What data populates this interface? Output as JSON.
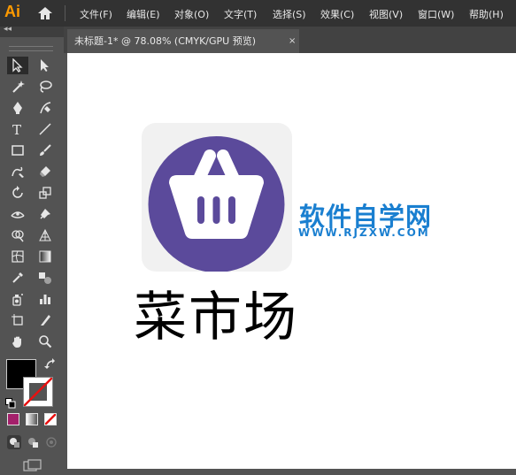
{
  "app": {
    "logo_text": "Ai"
  },
  "menu": [
    "文件(F)",
    "编辑(E)",
    "对象(O)",
    "文字(T)",
    "选择(S)",
    "效果(C)",
    "视图(V)",
    "窗口(W)",
    "帮助(H)"
  ],
  "tab": {
    "title": "未标题-1* @ 78.08% (CMYK/GPU 预览)",
    "close": "×"
  },
  "panel": {
    "collapse": "◂◂"
  },
  "canvas": {
    "title": "菜市场",
    "watermark": {
      "title": "软件自学网",
      "url": "WWW.RJZXW.COM"
    },
    "icon": {
      "background": "#f1f1f1",
      "circle": "#5b4a9b",
      "basket": "#ffffff"
    }
  },
  "swatches": {
    "fill": "#000000",
    "stroke": "none"
  },
  "tools": [
    "selection-tool-icon",
    "direct-selection-tool-icon",
    "magic-wand-tool-icon",
    "lasso-tool-icon",
    "pen-tool-icon",
    "curvature-tool-icon",
    "type-tool-icon",
    "line-segment-tool-icon",
    "rectangle-tool-icon",
    "paintbrush-tool-icon",
    "shaper-tool-icon",
    "eraser-tool-icon",
    "rotate-tool-icon",
    "scale-tool-icon",
    "width-tool-icon",
    "puppet-warp-tool-icon",
    "shape-builder-tool-icon",
    "perspective-grid-tool-icon",
    "mesh-tool-icon",
    "gradient-tool-icon",
    "eyedropper-tool-icon",
    "blend-tool-icon",
    "symbol-sprayer-tool-icon",
    "column-graph-tool-icon",
    "artboard-tool-icon",
    "slice-tool-icon",
    "hand-tool-icon",
    "zoom-tool-icon"
  ]
}
